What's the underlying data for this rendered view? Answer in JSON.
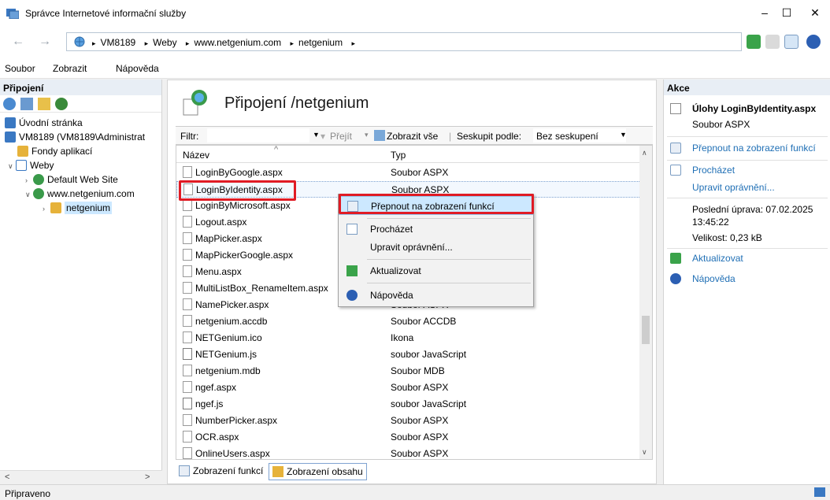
{
  "window": {
    "title": "Správce Internetové informační služby",
    "minimize": "–",
    "maximize": "☐",
    "close": "✕"
  },
  "address": {
    "back": "←",
    "forward": "→",
    "sep": "▸",
    "crumbs": [
      "VM8189",
      "Weby",
      "www.netgenium.com",
      "netgenium"
    ]
  },
  "menu": {
    "file": "Soubor",
    "view": "Zobrazit",
    "help": "Nápověda"
  },
  "left": {
    "header": "Připojení",
    "tree": {
      "start": "Úvodní stránka",
      "server": "VM8189 (VM8189\\Administrat",
      "pools": "Fondy aplikací",
      "sites": "Weby",
      "default_site": "Default Web Site",
      "site": "www.netgenium.com",
      "app": "netgenium"
    },
    "scroll_left": "<",
    "scroll_right": ">"
  },
  "center": {
    "title": "Připojení /netgenium",
    "filter_label": "Filtr:",
    "go": "Přejít",
    "show_all": "Zobrazit vše",
    "group_by": "Seskupit podle:",
    "group_value": "Bez seskupení",
    "col_name": "Název",
    "col_type": "Typ",
    "rows": [
      {
        "name": "LoginByGoogle.aspx",
        "type": "Soubor ASPX"
      },
      {
        "name": "LoginByIdentity.aspx",
        "type": "Soubor ASPX"
      },
      {
        "name": "LoginByMicrosoft.aspx",
        "type": ""
      },
      {
        "name": "Logout.aspx",
        "type": ""
      },
      {
        "name": "MapPicker.aspx",
        "type": ""
      },
      {
        "name": "MapPickerGoogle.aspx",
        "type": ""
      },
      {
        "name": "Menu.aspx",
        "type": ""
      },
      {
        "name": "MultiListBox_RenameItem.aspx",
        "type": ""
      },
      {
        "name": "NamePicker.aspx",
        "type": "Soubor ASPX"
      },
      {
        "name": "netgenium.accdb",
        "type": "Soubor ACCDB"
      },
      {
        "name": "NETGenium.ico",
        "type": "Ikona"
      },
      {
        "name": "NETGenium.js",
        "type": "soubor JavaScript"
      },
      {
        "name": "netgenium.mdb",
        "type": "Soubor MDB"
      },
      {
        "name": "ngef.aspx",
        "type": "Soubor ASPX"
      },
      {
        "name": "ngef.js",
        "type": "soubor JavaScript"
      },
      {
        "name": "NumberPicker.aspx",
        "type": "Soubor ASPX"
      },
      {
        "name": "OCR.aspx",
        "type": "Soubor ASPX"
      },
      {
        "name": "OnlineUsers.aspx",
        "type": "Soubor ASPX"
      }
    ],
    "tab_features": "Zobrazení funkcí",
    "tab_content": "Zobrazení obsahu"
  },
  "context_menu": {
    "switch": "Přepnout na zobrazení funkcí",
    "browse": "Procházet",
    "permissions": "Upravit oprávnění...",
    "refresh": "Aktualizovat",
    "help": "Nápověda"
  },
  "right": {
    "header": "Akce",
    "task_title": "Úlohy LoginByIdentity.aspx",
    "file_type": "Soubor ASPX",
    "switch": "Přepnout na zobrazení funkcí",
    "browse": "Procházet",
    "permissions": "Upravit oprávnění...",
    "modified": "Poslední úprava: 07.02.2025",
    "modified_time": "13:45:22",
    "size": "Velikost: 0,23 kB",
    "refresh": "Aktualizovat",
    "help": "Nápověda"
  },
  "status": {
    "text": "Připraveno"
  },
  "colors": {
    "highlight": "#e01b24",
    "link": "#1f6fb5",
    "selection": "#cce8ff"
  }
}
